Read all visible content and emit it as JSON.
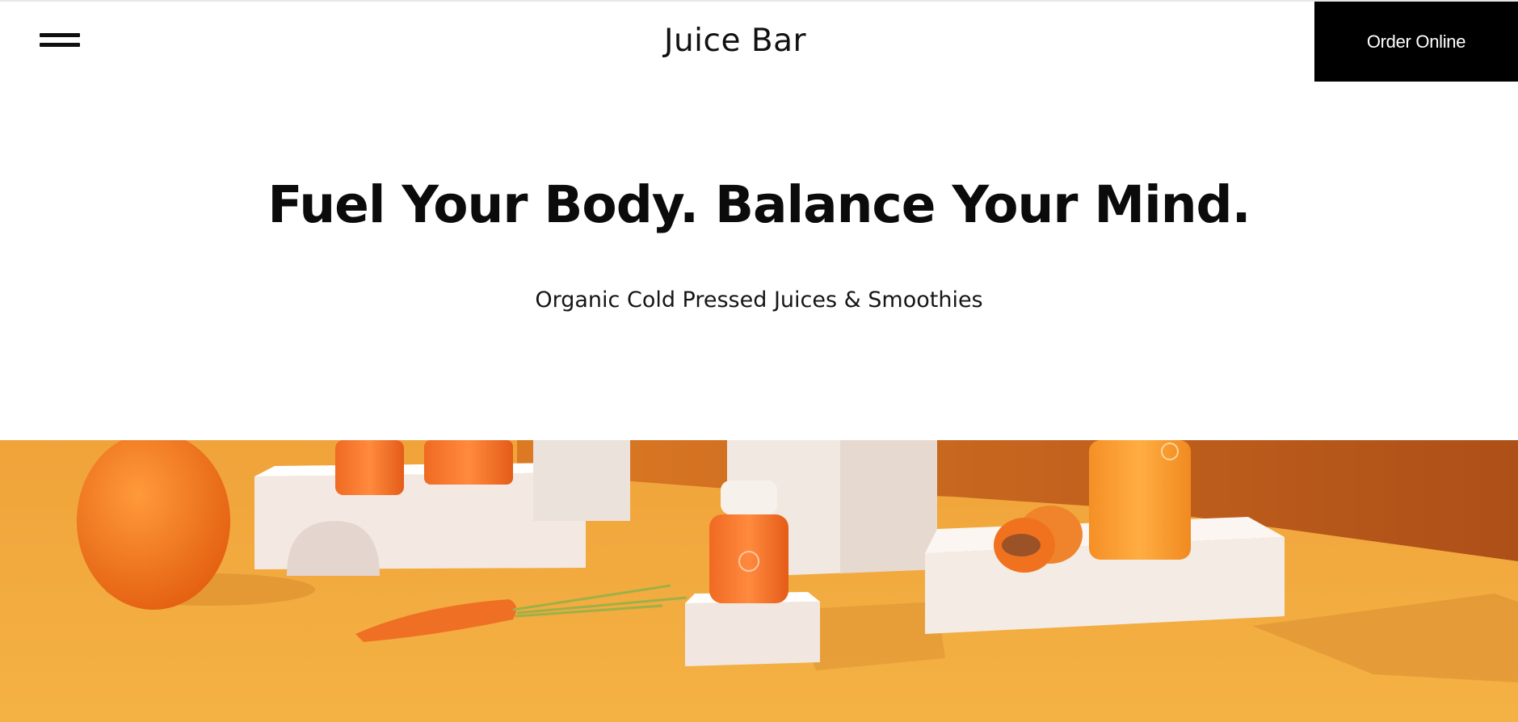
{
  "header": {
    "menu_icon": "hamburger-menu-icon",
    "site_title": "Juice Bar",
    "order_button_label": "Order Online"
  },
  "hero": {
    "headline": "Fuel Your Body. Balance Your Mind.",
    "subheadline": "Organic Cold Pressed Juices & Smoothies",
    "image_alt": "Orange juice bottles on white blocks with an orange, carrot and apricot"
  },
  "colors": {
    "background": "#ffffff",
    "text": "#111111",
    "button_bg": "#000000",
    "button_text": "#ffffff",
    "hero_floor": "#f2aa3a",
    "hero_wall": "#c8641e",
    "juice": "#ef6a1f"
  }
}
